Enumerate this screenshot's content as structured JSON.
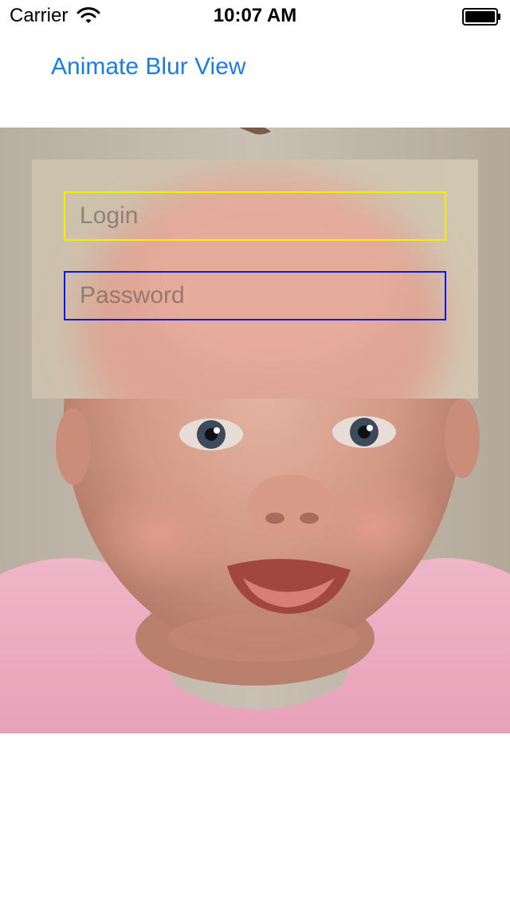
{
  "status_bar": {
    "carrier": "Carrier",
    "time": "10:07 AM",
    "wifi_icon": "wifi-icon",
    "battery_icon": "battery-icon"
  },
  "toolbar": {
    "animate_label": "Animate Blur View"
  },
  "form": {
    "login_placeholder": "Login",
    "login_value": "",
    "password_placeholder": "Password",
    "password_value": ""
  },
  "colors": {
    "link": "#1a7de6",
    "login_border": "#f5ee00",
    "password_border": "#0a18e6"
  }
}
